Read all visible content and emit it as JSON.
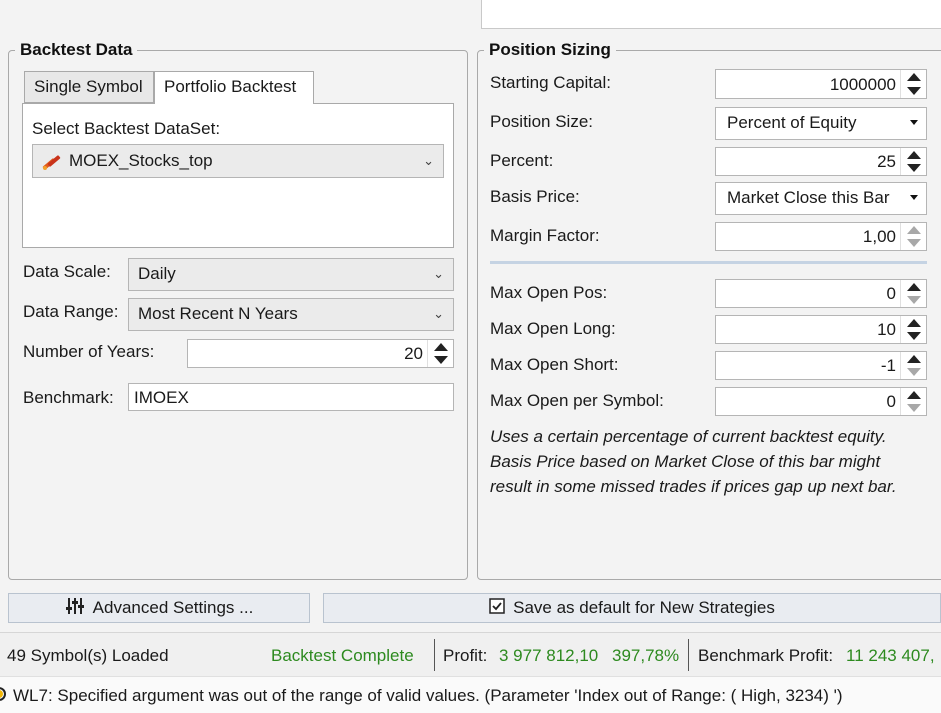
{
  "backtest_data": {
    "title": "Backtest Data",
    "tabs": [
      "Single Symbol",
      "Portfolio Backtest"
    ],
    "active_tab": "Portfolio Backtest",
    "dataset_label": "Select Backtest DataSet:",
    "dataset_value": "MOEX_Stocks_top",
    "data_scale_label": "Data Scale:",
    "data_scale_value": "Daily",
    "data_range_label": "Data Range:",
    "data_range_value": "Most Recent N Years",
    "years_label": "Number of Years:",
    "years_value": "20",
    "benchmark_label": "Benchmark:",
    "benchmark_value": "IMOEX"
  },
  "position_sizing": {
    "title": "Position Sizing",
    "starting_capital_label": "Starting Capital:",
    "starting_capital_value": "1000000",
    "position_size_label": "Position Size:",
    "position_size_value": "Percent of Equity",
    "percent_label": "Percent:",
    "percent_value": "25",
    "basis_price_label": "Basis Price:",
    "basis_price_value": "Market Close this Bar",
    "margin_factor_label": "Margin Factor:",
    "margin_factor_value": "1,00",
    "max_open_pos_label": "Max Open Pos:",
    "max_open_pos_value": "0",
    "max_open_long_label": "Max Open Long:",
    "max_open_long_value": "10",
    "max_open_short_label": "Max Open Short:",
    "max_open_short_value": "-1",
    "max_open_symbol_label": "Max Open per Symbol:",
    "max_open_symbol_value": "0",
    "description_lines": [
      "Uses a certain percentage of current backtest equity.",
      "Basis Price based on Market Close of this bar might",
      "result in some missed trades if prices gap up next bar."
    ]
  },
  "buttons": {
    "advanced_settings": "Advanced Settings ...",
    "save_default": "Save as default for New Strategies"
  },
  "status": {
    "symbols_loaded": "49 Symbol(s) Loaded",
    "backtest_state": "Backtest Complete",
    "profit_label": "Profit:",
    "profit_value": "3 977 812,10",
    "profit_pct": "397,78%",
    "benchmark_profit_label": "Benchmark Profit:",
    "benchmark_profit_value": "11 243 407,"
  },
  "message": "WL7: Specified argument was out of the range of valid values. (Parameter 'Index out of Range: ( High, 3234) ')",
  "colors": {
    "accent_green": "#2d8a1f",
    "warning_yellow": "#f2b705"
  }
}
